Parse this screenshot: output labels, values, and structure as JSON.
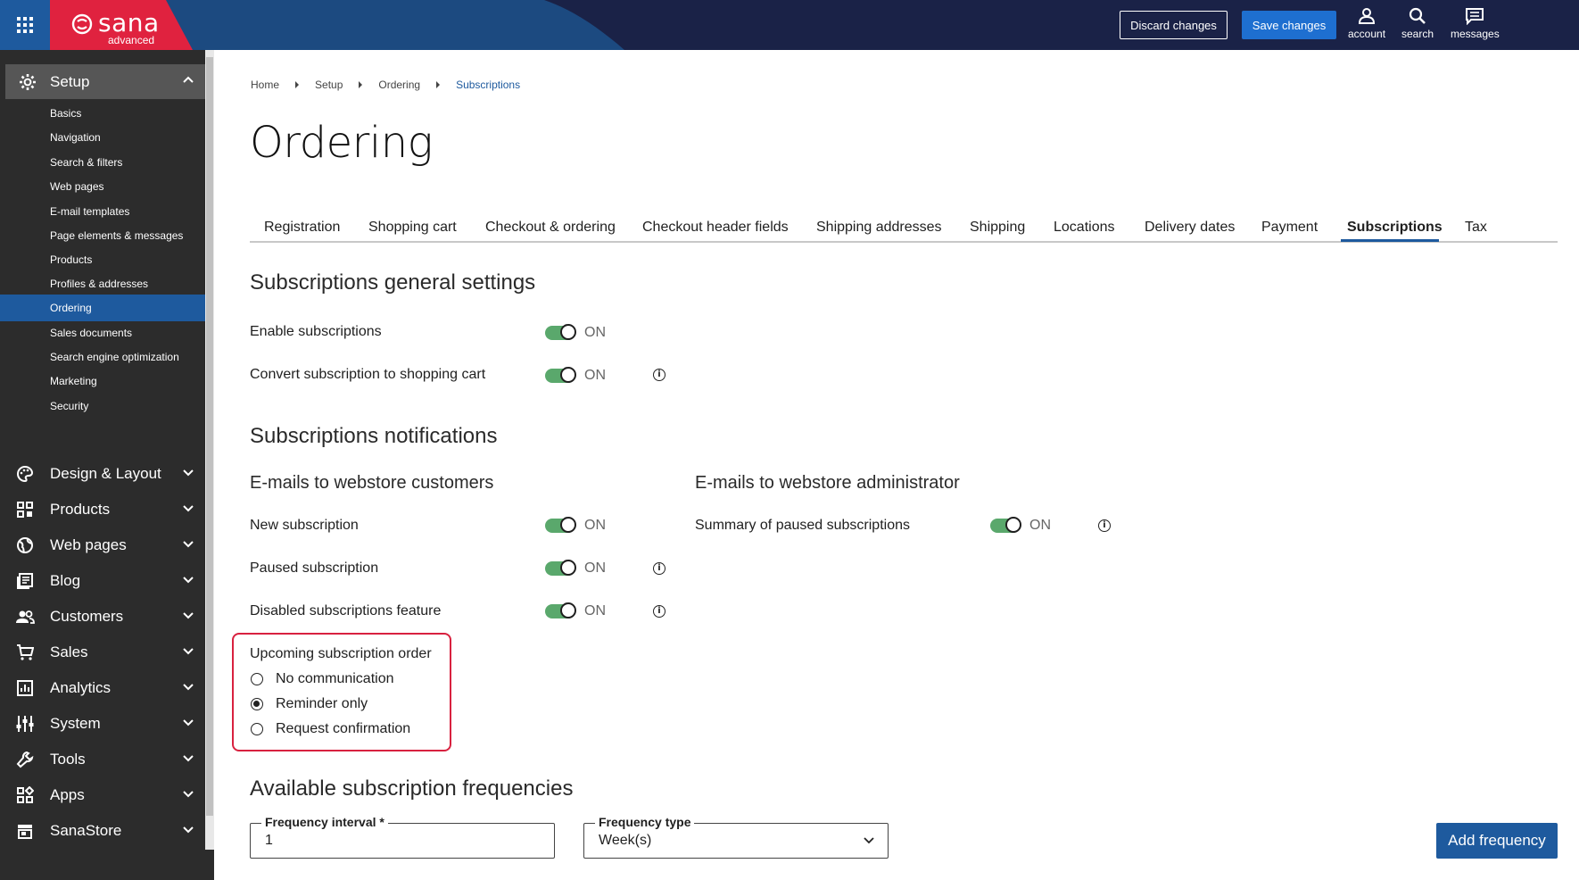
{
  "header": {
    "logo_text": "sana",
    "logo_sub": "advanced",
    "discard_label": "Discard changes",
    "save_label": "Save changes",
    "account_label": "account",
    "search_label": "search",
    "messages_label": "messages"
  },
  "sidebar": {
    "setup_label": "Setup",
    "sub_items": [
      "Basics",
      "Navigation",
      "Search & filters",
      "Web pages",
      "E-mail templates",
      "Page elements & messages",
      "Products",
      "Profiles & addresses",
      "Ordering",
      "Sales documents",
      "Search engine optimization",
      "Marketing",
      "Security"
    ],
    "active_sub": "Ordering",
    "main_items": [
      "Design & Layout",
      "Products",
      "Web pages",
      "Blog",
      "Customers",
      "Sales",
      "Analytics",
      "System",
      "Tools",
      "Apps",
      "SanaStore"
    ]
  },
  "breadcrumb": [
    "Home",
    "Setup",
    "Ordering",
    "Subscriptions"
  ],
  "page_title": "Ordering",
  "tabs": [
    "Registration",
    "Shopping cart",
    "Checkout & ordering",
    "Checkout header fields",
    "Shipping addresses",
    "Shipping",
    "Locations",
    "Delivery dates",
    "Payment",
    "Subscriptions",
    "Tax"
  ],
  "active_tab": "Subscriptions",
  "general": {
    "title": "Subscriptions general settings",
    "enable_label": "Enable subscriptions",
    "enable_state": "ON",
    "convert_label": "Convert subscription to shopping cart",
    "convert_state": "ON"
  },
  "notifications": {
    "title": "Subscriptions notifications",
    "customers_title": "E-mails to webstore customers",
    "admin_title": "E-mails to webstore administrator",
    "new_label": "New subscription",
    "new_state": "ON",
    "paused_label": "Paused subscription",
    "paused_state": "ON",
    "disabled_label": "Disabled subscriptions feature",
    "disabled_state": "ON",
    "summary_label": "Summary of paused subscriptions",
    "summary_state": "ON",
    "upcoming_label": "Upcoming subscription order",
    "upcoming_options": [
      "No communication",
      "Reminder only",
      "Request confirmation"
    ],
    "upcoming_selected": "Reminder only"
  },
  "frequencies": {
    "title": "Available subscription frequencies",
    "interval_label": "Frequency interval *",
    "interval_value": "1",
    "type_label": "Frequency type",
    "type_value": "Week(s)",
    "add_label": "Add frequency"
  },
  "colors": {
    "header_bg": "#1a2247",
    "logo_red": "#e0223f",
    "accent_blue": "#1e5a9e",
    "toggle_green": "#5aa86c",
    "highlight_red": "#d8213f"
  }
}
